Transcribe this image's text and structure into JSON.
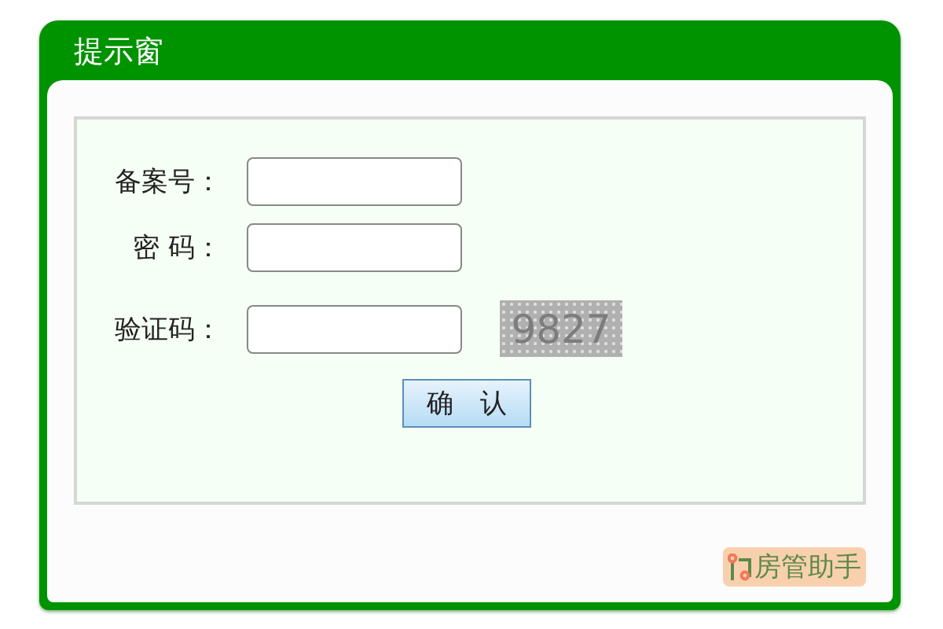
{
  "window": {
    "title": "提示窗"
  },
  "fields": [
    {
      "label": "备案号：",
      "kind": "text"
    },
    {
      "label": "密 码：",
      "kind": "password"
    },
    {
      "label": "验证码：",
      "kind": "captcha",
      "captcha": "9827"
    }
  ],
  "confirm_button": "确　认",
  "badge": "房管助手"
}
